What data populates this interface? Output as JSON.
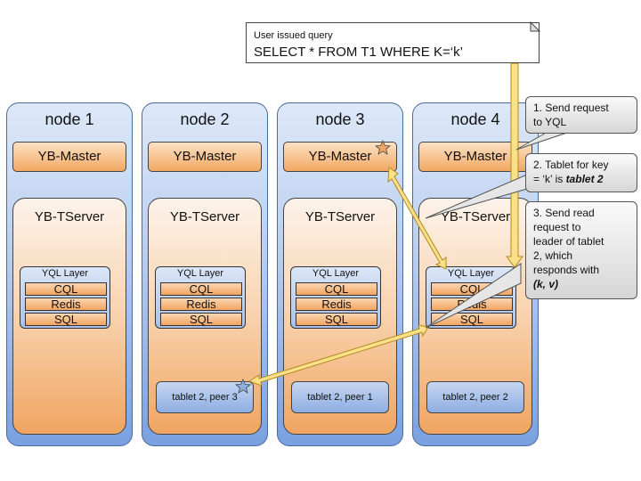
{
  "query": {
    "caption": "User issued query",
    "statement": "SELECT * FROM T1 WHERE K=‘k’"
  },
  "nodes": [
    {
      "title": "node 1",
      "master": "YB-Master",
      "tserver": "YB-TServer",
      "yql_title": "YQL Layer",
      "apis": [
        "CQL",
        "Redis",
        "SQL"
      ],
      "tablet": ""
    },
    {
      "title": "node 2",
      "master": "YB-Master",
      "tserver": "YB-TServer",
      "yql_title": "YQL Layer",
      "apis": [
        "CQL",
        "Redis",
        "SQL"
      ],
      "tablet": "tablet 2, peer 3"
    },
    {
      "title": "node 3",
      "master": "YB-Master",
      "tserver": "YB-TServer",
      "yql_title": "YQL Layer",
      "apis": [
        "CQL",
        "Redis",
        "SQL"
      ],
      "tablet": "tablet 2, peer 1"
    },
    {
      "title": "node 4",
      "master": "YB-Master",
      "tserver": "YB-TServer",
      "yql_title": "YQL Layer",
      "apis": [
        "CQL",
        "Redis",
        "SQL"
      ],
      "tablet": "tablet 2, peer 2"
    }
  ],
  "callouts": [
    {
      "lines": [
        "1. Send request",
        "to YQL"
      ]
    },
    {
      "line1": "2. Tablet for key",
      "line2_prefix": "= ‘k’ is ",
      "line2_emph": "tablet 2"
    },
    {
      "lines": [
        "3. Send read",
        "request to",
        "leader of tablet",
        "2, which",
        "responds with"
      ],
      "emph": "(k, v)"
    }
  ],
  "markers": {
    "leader_master": "star-icon",
    "tablet_leader": "star-icon"
  },
  "colors": {
    "arrow_fill": "#fbe08a",
    "arrow_stroke": "#b08a20",
    "orange_star": "#f0a561",
    "blue_star": "#8eaee3"
  }
}
